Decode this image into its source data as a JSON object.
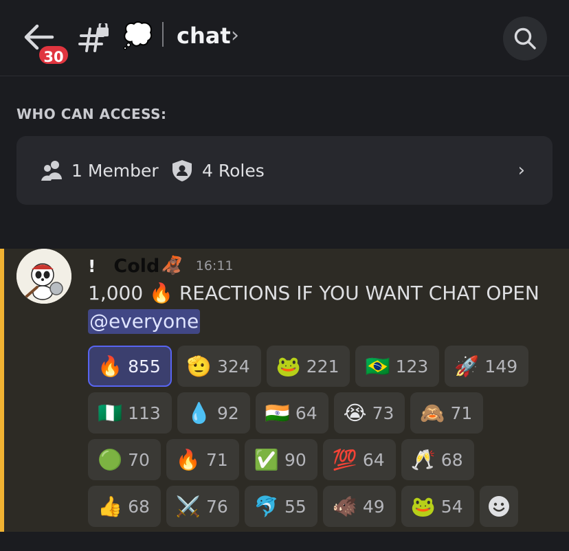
{
  "header": {
    "back_badge": "30",
    "channel_status_emoji": "💭",
    "channel_name": "chat",
    "icons": [
      "back-arrow-icon",
      "locked-channel-icon",
      "chevron-right-icon",
      "search-icon"
    ]
  },
  "access": {
    "label": "WHO CAN ACCESS:",
    "members": "1 Member",
    "roles": "4 Roles",
    "icons": [
      "members-icon",
      "shield-icon",
      "chevron-right-icon"
    ]
  },
  "message": {
    "prefix": "!",
    "username": "Cold",
    "username_emoji": "🦧",
    "time": "16:11",
    "text": "1,000 🔥 REACTIONS IF YOU WANT CHAT OPEN",
    "mention": "@everyone",
    "accent_color": "#f0b232"
  },
  "reactions": [
    [
      {
        "emoji": "🔥",
        "count": "855",
        "active": true
      },
      {
        "emoji": "🫡",
        "count": "324"
      },
      {
        "emoji": "🐸",
        "count": "221"
      },
      {
        "emoji": "🇧🇷",
        "count": "123"
      },
      {
        "emoji": "🚀",
        "count": "149"
      }
    ],
    [
      {
        "emoji": "🇳🇬",
        "count": "113"
      },
      {
        "emoji": "💧",
        "count": "92"
      },
      {
        "emoji": "🇮🇳",
        "count": "64"
      },
      {
        "emoji": "😭",
        "count": "73"
      },
      {
        "emoji": "🙈",
        "count": "71"
      }
    ],
    [
      {
        "emoji": "🟢",
        "count": "70"
      },
      {
        "emoji": "🔥",
        "count": "71"
      },
      {
        "emoji": "✅",
        "count": "90"
      },
      {
        "emoji": "💯",
        "count": "64"
      },
      {
        "emoji": "🥂",
        "count": "68"
      }
    ],
    [
      {
        "emoji": "👍",
        "count": "68"
      },
      {
        "emoji": "⚔️",
        "count": "76"
      },
      {
        "emoji": "🐬",
        "count": "55"
      },
      {
        "emoji": "🐗",
        "count": "49"
      },
      {
        "emoji": "🐸",
        "count": "54"
      }
    ]
  ],
  "add_reaction_icon": "add-reaction-smile-icon"
}
